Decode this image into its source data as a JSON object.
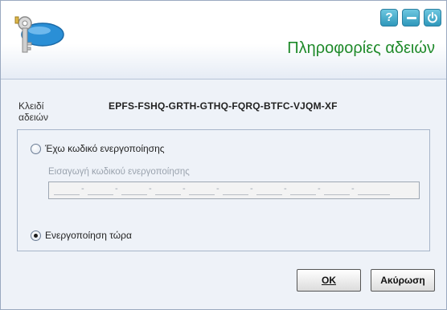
{
  "header": {
    "title": "Πληροφορίες αδειών",
    "help_glyph": "?"
  },
  "license": {
    "label": "Κλειδί αδειών",
    "key": "EPFS-FSHQ-GRTH-GTHQ-FQRQ-BTFC-VJQM-XF"
  },
  "options": {
    "have_code": {
      "label": "Έχω κωδικό ενεργοποίησης",
      "checked": false
    },
    "code_field_label": "Εισαγωγή κωδικού ενεργοποίησης",
    "code_segments": [
      "",
      "",
      "",
      "",
      "",
      "",
      "",
      "",
      "",
      ""
    ],
    "activate_now": {
      "label": "Ενεργοποίηση τώρα",
      "checked": true
    }
  },
  "buttons": {
    "ok": "OK",
    "cancel": "Ακύρωση"
  },
  "icons": {
    "logo": "keys-logo-icon",
    "help": "help-icon",
    "minimize": "minimize-icon",
    "power": "power-icon"
  },
  "colors": {
    "title": "#1f8a2a",
    "window_button": "#2f98bb"
  }
}
